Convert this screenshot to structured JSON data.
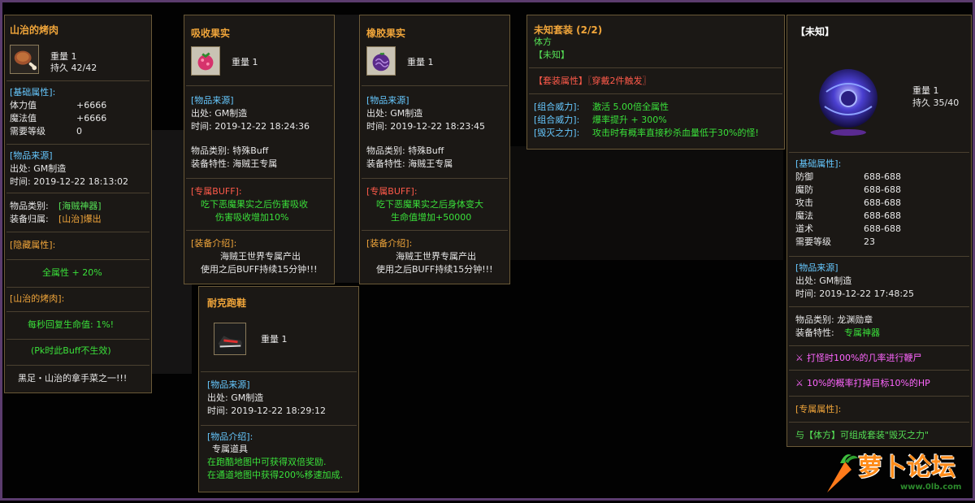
{
  "panels": {
    "meat": {
      "title": "山治的烤肉",
      "weight": "重量 1",
      "durability": "持久 42/42",
      "basic_attr_header": "[基础属性]:",
      "stats": [
        {
          "label": "体力值",
          "value": "+6666"
        },
        {
          "label": "魔法值",
          "value": "+6666"
        },
        {
          "label": "需要等级",
          "value": "0"
        }
      ],
      "source_header": "[物品来源]",
      "source": "出处: GM制造",
      "time": "时间: 2019-12-22 18:13:02",
      "category_label": "物品类别:",
      "category_value": "[海贼神器]",
      "owner_label": "装备归属:",
      "owner_value": "[山治]爆出",
      "hidden_header": "[隐藏属性]:",
      "all_attr": "全属性 + 20%",
      "name_tag": "[山治的烤肉]:",
      "regen": "每秒回复生命值: 1%!",
      "pk_note": "(Pk时此Buff不生效)",
      "desc": "黑足・山治的拿手菜之一!!!"
    },
    "absorb": {
      "title": "吸收果实",
      "weight": "重量 1",
      "source_header": "[物品来源]",
      "source": "出处: GM制造",
      "time": "时间: 2019-12-22 18:24:36",
      "category": "物品类别: 特殊Buff",
      "feature": "装备特性: 海贼王专属",
      "buff_header": "[专属BUFF]:",
      "buff_line1": "吃下恶魔果实之后伤害吸收",
      "buff_line2": "伤害吸收增加10%",
      "intro_header": "[装备介绍]:",
      "intro_line1": "海贼王世界专属产出",
      "intro_line2": "使用之后BUFF持续15分钟!!!"
    },
    "rubber": {
      "title": "橡胶果实",
      "weight": "重量 1",
      "source_header": "[物品来源]",
      "source": "出处: GM制造",
      "time": "时间: 2019-12-22 18:23:45",
      "category": "物品类别: 特殊Buff",
      "feature": "装备特性: 海贼王专属",
      "buff_header": "[专属BUFF]:",
      "buff_line1": "吃下恶魔果实之后身体变大",
      "buff_line2": "生命值增加+50000",
      "intro_header": "[装备介绍]:",
      "intro_line1": "海贼王世界专属产出",
      "intro_line2": "使用之后BUFF持续15分钟!!!"
    },
    "shoes": {
      "title": "耐克跑鞋",
      "weight": "重量 1",
      "source_header": "[物品来源]",
      "source": "出处: GM制造",
      "time": "时间: 2019-12-22 18:29:12",
      "intro_header": "[物品介绍]:",
      "intro_line1": "专属道具",
      "intro_line2": "在跑酷地图中可获得双倍奖励.",
      "intro_line3": "在通道地图中获得200%移速加成."
    },
    "set": {
      "title": "未知套装 (2/2)",
      "member1": "体方",
      "member2": "【未知】",
      "set_header": "【套装属性】〖穿戴2件触发〗",
      "power1_label": "[组合威力]:",
      "power1_value": "激活 5.00倍全属性",
      "power2_label": "[组合威力]:",
      "power2_value": "爆率提升 + 300%",
      "power3_label": "[毁灭之力]:",
      "power3_value": "攻击时有概率直接秒杀血量低于30%的怪!"
    },
    "unknown": {
      "title": "【未知】",
      "weight": "重量 1",
      "durability": "持久 35/40",
      "basic_attr_header": "[基础属性]:",
      "stats": [
        {
          "label": "防御",
          "value": "688-688"
        },
        {
          "label": "魔防",
          "value": "688-688"
        },
        {
          "label": "攻击",
          "value": "688-688"
        },
        {
          "label": "魔法",
          "value": "688-688"
        },
        {
          "label": "道术",
          "value": "688-688"
        },
        {
          "label": "需要等级",
          "value": "23"
        }
      ],
      "source_header": "[物品来源]",
      "source": "出处: GM制造",
      "time": "时间: 2019-12-22 17:48:25",
      "category": "物品类别: 龙渊勋章",
      "feature_label": "装备特性:",
      "feature_value": "专属神器",
      "effect1": "打怪时100%的几率进行鞭尸",
      "effect2": "10%的概率打掉目标10%的HP",
      "exclusive_header": "[专属属性]:",
      "set_note": "与【体方】可组成套装\"毁灭之力\""
    }
  },
  "watermark": {
    "brand": "萝卜论坛",
    "url": "www.0lb.com"
  },
  "colors": {
    "title": "#f0a53a",
    "header": "#66c8ff",
    "green": "#3ae03a",
    "red": "#ff5a4a",
    "pink": "#ff66ff",
    "frame": "#5b3c6e"
  }
}
